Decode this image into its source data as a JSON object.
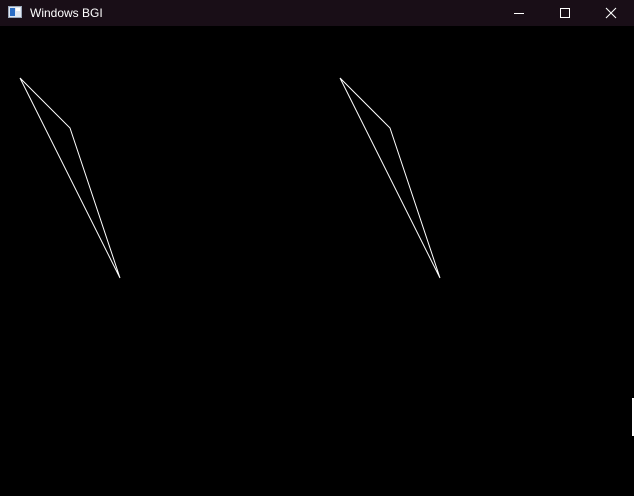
{
  "window": {
    "title": "Windows BGI",
    "title_icon": "bgi-app-icon",
    "controls": {
      "minimize_icon": "minimize-icon",
      "maximize_icon": "maximize-icon",
      "close_icon": "close-icon"
    },
    "colors": {
      "titlebar_bg": "#190e17",
      "canvas_bg": "#000000",
      "stroke": "#ffffff"
    }
  },
  "drawing": {
    "shapes": [
      {
        "kind": "polygon",
        "name": "left-kite-shape"
      },
      {
        "kind": "polygon",
        "name": "right-kite-shape"
      }
    ]
  }
}
